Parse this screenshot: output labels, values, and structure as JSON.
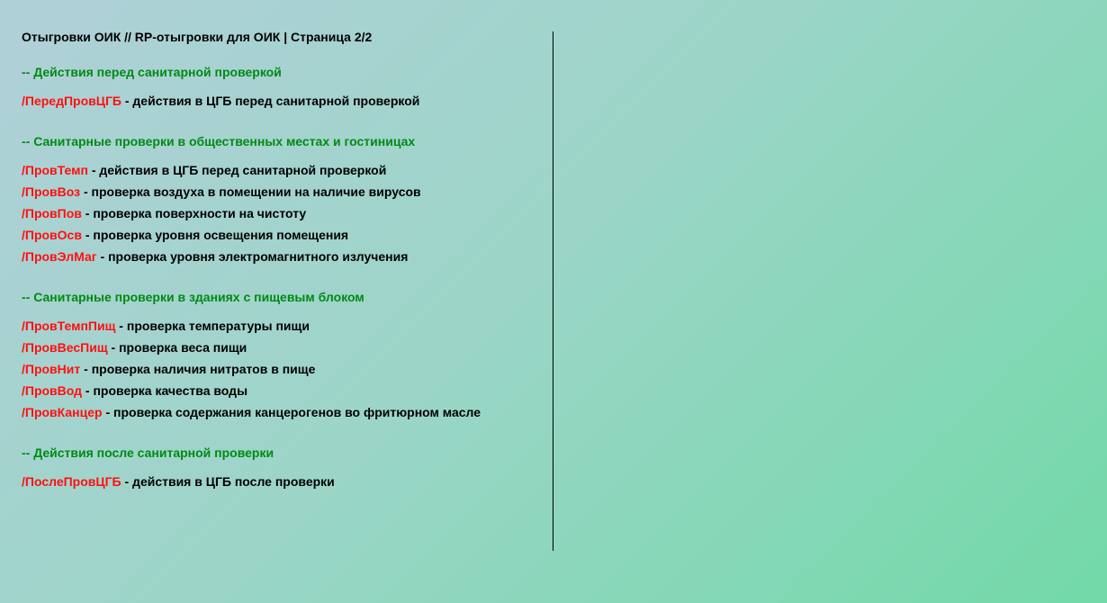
{
  "page": {
    "title": "Отыгровки ОИК // RP-отыгровки для ОИК | Страница 2/2"
  },
  "sections": [
    {
      "heading": "-- Действия перед санитарной проверкой",
      "commands": [
        {
          "cmd": "/ПередПровЦГБ",
          "desc": " - действия в ЦГБ перед санитарной проверкой"
        }
      ]
    },
    {
      "heading": "-- Санитарные проверки в общественных местах и гостиницах",
      "commands": [
        {
          "cmd": "/ПровТемп",
          "desc": " - действия в ЦГБ перед санитарной проверкой"
        },
        {
          "cmd": "/ПровВоз",
          "desc": " - проверка воздуха в помещении на наличие вирусов"
        },
        {
          "cmd": "/ПровПов",
          "desc": " - проверка поверхности на чистоту"
        },
        {
          "cmd": "/ПровОсв",
          "desc": " - проверка уровня освещения помещения"
        },
        {
          "cmd": "/ПровЭлМаг",
          "desc": " - проверка уровня электромагнитного излучения"
        }
      ]
    },
    {
      "heading": "-- Санитарные проверки в зданиях с пищевым блоком",
      "commands": [
        {
          "cmd": "/ПровТемпПищ",
          "desc": " - проверка температуры пищи"
        },
        {
          "cmd": "/ПровВесПищ",
          "desc": " - проверка веса пищи"
        },
        {
          "cmd": "/ПровНит",
          "desc": " - проверка наличия нитратов в пище"
        },
        {
          "cmd": "/ПровВод",
          "desc": " - проверка качества воды"
        },
        {
          "cmd": "/ПровКанцер",
          "desc": " - проверка содержания канцерогенов во фритюрном масле"
        }
      ]
    },
    {
      "heading": "-- Действия после санитарной проверки",
      "commands": [
        {
          "cmd": "/ПослеПровЦГБ",
          "desc": " - действия в ЦГБ после проверки"
        }
      ]
    }
  ],
  "colors": {
    "command": "#ff1010",
    "heading": "#008a14",
    "text": "#000000"
  }
}
